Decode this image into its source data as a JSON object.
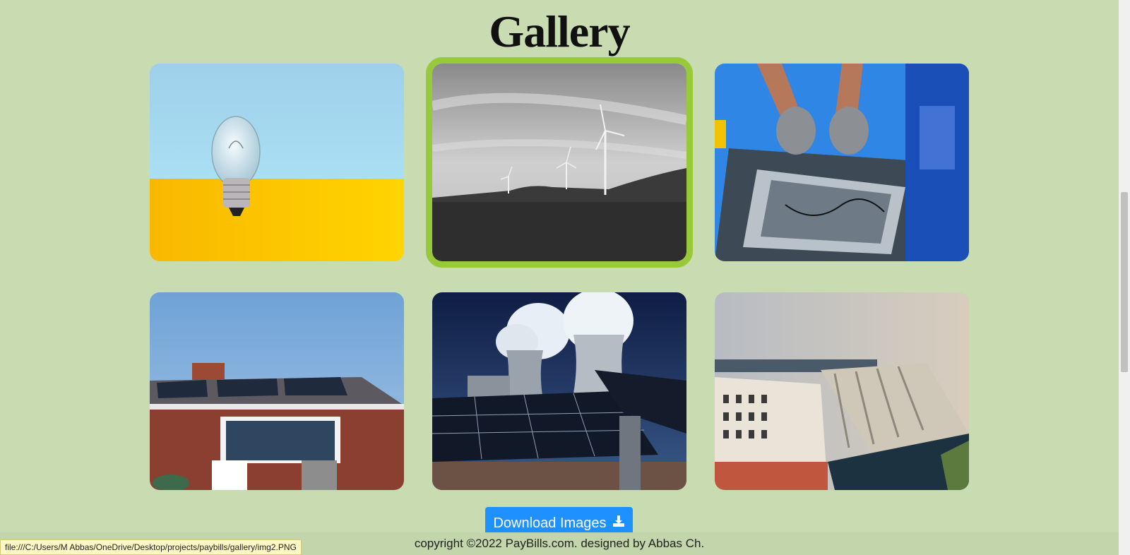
{
  "page": {
    "title": "Gallery",
    "download_label": "Download Images",
    "footer_text": "copyright ©2022 PayBills.com. designed by Abbas Ch.",
    "status_url": "file:///C:/Users/M Abbas/OneDrive/Desktop/projects/paybills/gallery/img2.PNG"
  },
  "colors": {
    "background": "#c9dcb1",
    "active_outline": "#98c93b",
    "button": "#1e90ff"
  },
  "gallery": {
    "images": [
      {
        "name": "light-bulb-image"
      },
      {
        "name": "wind-turbines-image",
        "active": true
      },
      {
        "name": "solar-installer-hands-image"
      },
      {
        "name": "house-solar-roof-image"
      },
      {
        "name": "cooling-towers-solar-image"
      },
      {
        "name": "hydro-dam-image"
      }
    ]
  }
}
